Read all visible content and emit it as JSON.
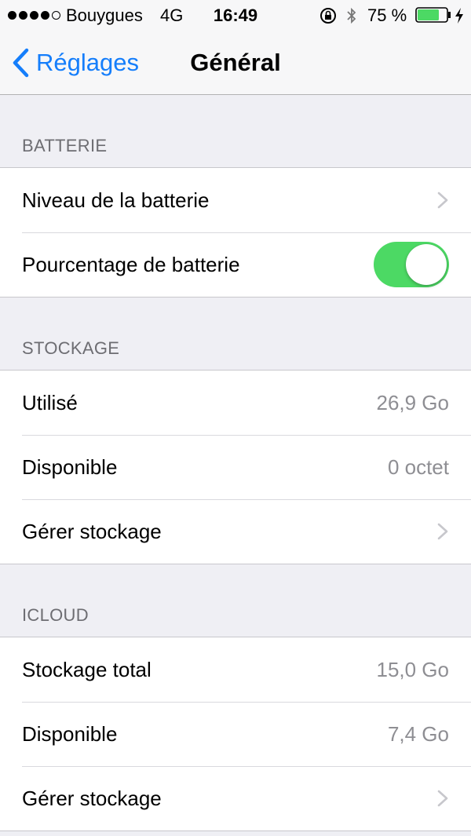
{
  "status_bar": {
    "carrier": "Bouygues",
    "network": "4G",
    "time": "16:49",
    "battery_percent": "75 %",
    "battery_level": 0.75,
    "signal_bars_filled": 4,
    "signal_bars_total": 5
  },
  "nav": {
    "back_label": "Réglages",
    "title": "Général"
  },
  "sections": {
    "battery": {
      "header": "BATTERIE",
      "rows": {
        "level": {
          "label": "Niveau de la batterie"
        },
        "percentage": {
          "label": "Pourcentage de batterie",
          "toggle_on": true
        }
      }
    },
    "storage": {
      "header": "STOCKAGE",
      "rows": {
        "used": {
          "label": "Utilisé",
          "value": "26,9 Go"
        },
        "available": {
          "label": "Disponible",
          "value": "0 octet"
        },
        "manage": {
          "label": "Gérer stockage"
        }
      }
    },
    "icloud": {
      "header": "ICLOUD",
      "rows": {
        "total": {
          "label": "Stockage total",
          "value": "15,0 Go"
        },
        "available": {
          "label": "Disponible",
          "value": "7,4 Go"
        },
        "manage": {
          "label": "Gérer stockage"
        }
      }
    }
  },
  "colors": {
    "accent": "#157efb",
    "toggle_on": "#4cd964",
    "background": "#efeff4",
    "secondary_text": "#8e8e93"
  }
}
